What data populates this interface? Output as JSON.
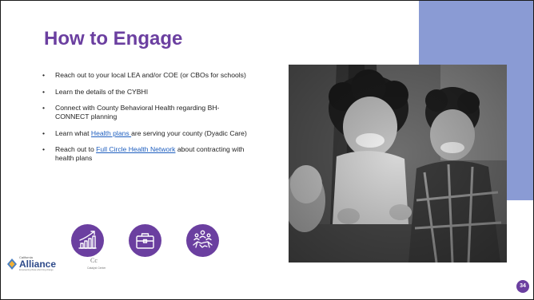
{
  "slide": {
    "title": "How to Engage",
    "bullets": [
      {
        "text": "Reach out to your local LEA and/or COE (or CBOs for schools)"
      },
      {
        "text": "Learn the details of the CYBHI"
      },
      {
        "text": "Connect with County Behavioral Health regarding BH-CONNECT planning"
      },
      {
        "before": "Learn what ",
        "link": "Health plans ",
        "after": "are serving your county (Dyadic Care)"
      },
      {
        "before": "Reach out to ",
        "link": "Full Circle Health Network",
        "after": " about contracting with health plans"
      }
    ],
    "icons": [
      "growth-chart-icon",
      "briefcase-icon",
      "partnership-handshake-icon"
    ],
    "page_number": "34"
  },
  "footer": {
    "logo_small_text": "California",
    "logo_text": "Alliance",
    "logo_tagline": "Empowering those who bring change",
    "logo2_mark": "Cc",
    "logo2_text": "Catalyst Center"
  },
  "colors": {
    "title": "#6b3fa0",
    "accent_block": "#8a9bd4",
    "icon_circle": "#6b3fa0",
    "link": "#1f5fbf"
  }
}
